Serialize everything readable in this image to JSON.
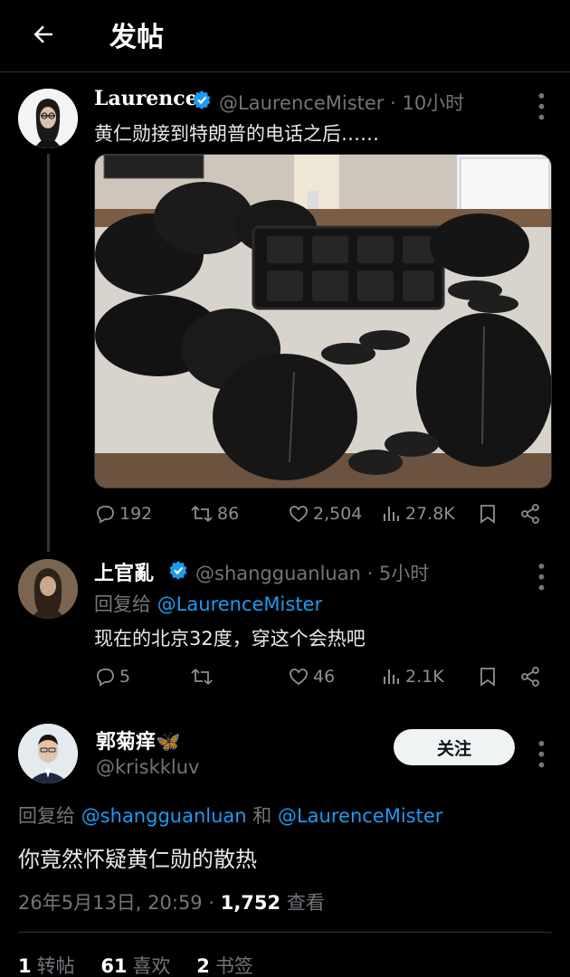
{
  "header": {
    "title": "发帖"
  },
  "post1": {
    "display_name": "Laurence",
    "handle_time": "@LaurenceMister · 10小时",
    "text": "黄仁勋接到特朗普的电话之后……",
    "image_alt": "photo of many leather jackets on a bed",
    "actions": {
      "replies": "192",
      "reposts": "86",
      "likes": "2,504",
      "views": "27.8K"
    }
  },
  "post2": {
    "display_name": "上官亂",
    "handle_time": "@shangguanluan · 5小时",
    "reply_prefix": "回复给",
    "reply_to": "@LaurenceMister",
    "text": "现在的北京32度，穿这个会热吧",
    "actions": {
      "replies": "5",
      "reposts": "",
      "likes": "46",
      "views": "2.1K"
    }
  },
  "post3": {
    "display_name": "郭菊痒",
    "emoji": "🦋",
    "handle": "@kriskkluv",
    "follow_label": "关注",
    "reply_prefix": "回复给",
    "reply_to_1": "@shangguanluan",
    "reply_and": "和",
    "reply_to_2": "@LaurenceMister",
    "text": "你竟然怀疑黄仁勋的散热",
    "timestamp": "26年5月13日, 20:59 · ",
    "views_count": "1,752",
    "views_label": "查看"
  },
  "stats": {
    "reposts_count": "1",
    "reposts_label": "转帖",
    "likes_count": "61",
    "likes_label": "喜欢",
    "bookmarks_count": "2",
    "bookmarks_label": "书签"
  },
  "colors": {
    "background": "#000000",
    "accent": "#1d9bf0",
    "verified": "#1d9bf0",
    "muted": "#71767b"
  }
}
